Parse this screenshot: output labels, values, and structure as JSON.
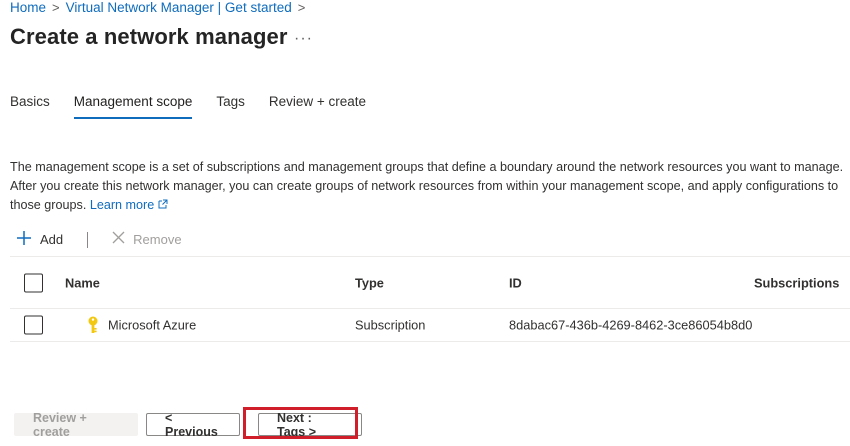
{
  "breadcrumb": {
    "items": [
      "Home",
      "Virtual Network Manager | Get started"
    ],
    "separator": ">"
  },
  "page": {
    "title": "Create a network manager",
    "more_label": "···"
  },
  "tabs": [
    {
      "label": "Basics",
      "active": false
    },
    {
      "label": "Management scope",
      "active": true
    },
    {
      "label": "Tags",
      "active": false
    },
    {
      "label": "Review + create",
      "active": false
    }
  ],
  "description": {
    "text": "The management scope is a set of subscriptions and management groups that define a boundary around the network resources you want to manage. After you create this network manager, you can create groups of network resources from within your management scope, and apply configurations to those groups.",
    "link": "Learn more"
  },
  "toolbar": {
    "add_label": "Add",
    "add_icon": "plus-icon",
    "remove_label": "Remove",
    "remove_icon": "x-icon"
  },
  "table": {
    "columns": [
      "Name",
      "Type",
      "ID",
      "Subscriptions"
    ],
    "rows": [
      {
        "name": "Microsoft Azure",
        "type": "Subscription",
        "id": "8dabac67-436b-4269-8462-3ce86054b8d0",
        "subscriptions": "",
        "icon": "key-icon"
      }
    ]
  },
  "footer": {
    "review_label": "Review + create",
    "previous_label": "< Previous",
    "next_label": "Next : Tags >"
  },
  "colors": {
    "accent": "#0f6cbd",
    "highlight": "#d01f2b",
    "key_icon": "#f2c811"
  }
}
